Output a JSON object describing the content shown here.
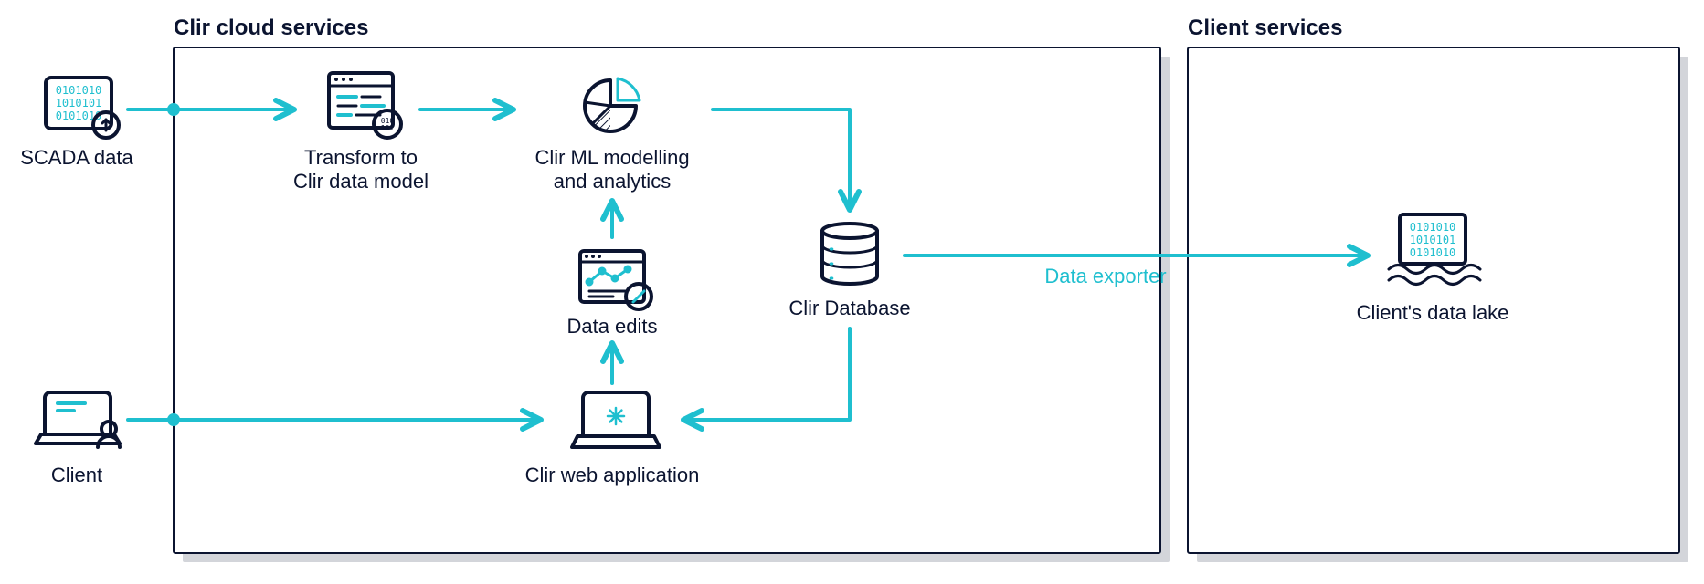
{
  "headers": {
    "cloud": "Clir cloud services",
    "client": "Client services"
  },
  "nodes": {
    "scada": "SCADA data",
    "transform_l1": "Transform to",
    "transform_l2": "Clir data model",
    "ml_l1": "Clir ML modelling",
    "ml_l2": "and analytics",
    "edits": "Data edits",
    "database": "Clir Database",
    "webapp": "Clir web application",
    "client": "Client",
    "lake": "Client's data lake"
  },
  "edges": {
    "exporter": "Data exporter"
  },
  "iconText": {
    "binary_l1": "0101010",
    "binary_l2": "1010101",
    "binary_l3": "0101010"
  }
}
